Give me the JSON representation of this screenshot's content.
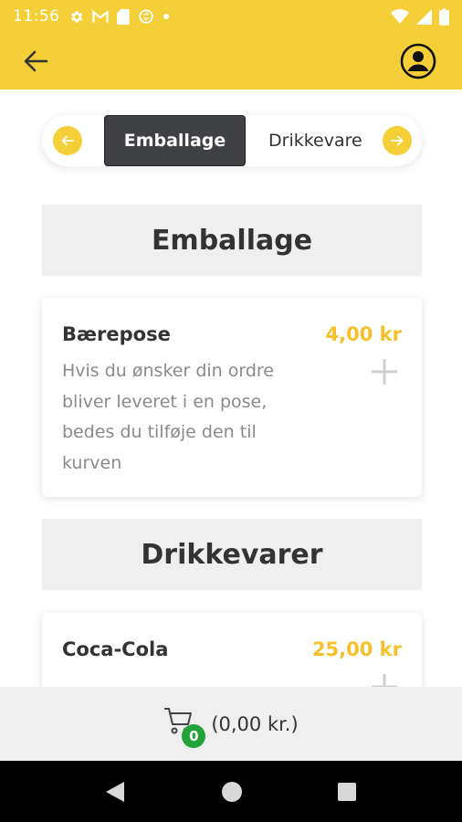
{
  "status_bar": {
    "time": "11:56",
    "icons": [
      "gear-icon",
      "gmail-icon",
      "sim-card-icon",
      "sync-icon",
      "dot-icon",
      "wifi-icon",
      "signal-icon",
      "battery-icon"
    ]
  },
  "app_bar": {
    "back_icon": "arrow-left-icon",
    "profile_icon": "account-icon"
  },
  "category_nav": {
    "tabs": [
      {
        "label": "Emballage",
        "active": true
      },
      {
        "label": "Drikkevarer",
        "active": false
      }
    ]
  },
  "sections": [
    {
      "title": "Emballage",
      "products": [
        {
          "name": "Bærepose",
          "price": "4,00 kr",
          "description": "Hvis du ønsker din ordre bliver leveret i en pose, bedes du tilføje den til kurven"
        }
      ]
    },
    {
      "title": "Drikkevarer",
      "products": [
        {
          "name": "Coca-Cola",
          "price": "25,00 kr",
          "description": ""
        }
      ]
    }
  ],
  "cart": {
    "count": "0",
    "total": "(0,00 kr.)"
  },
  "colors": {
    "accent": "#f5cf37",
    "price": "#f5c02a",
    "badge": "#22a33a",
    "active_tab": "#3f4144"
  }
}
